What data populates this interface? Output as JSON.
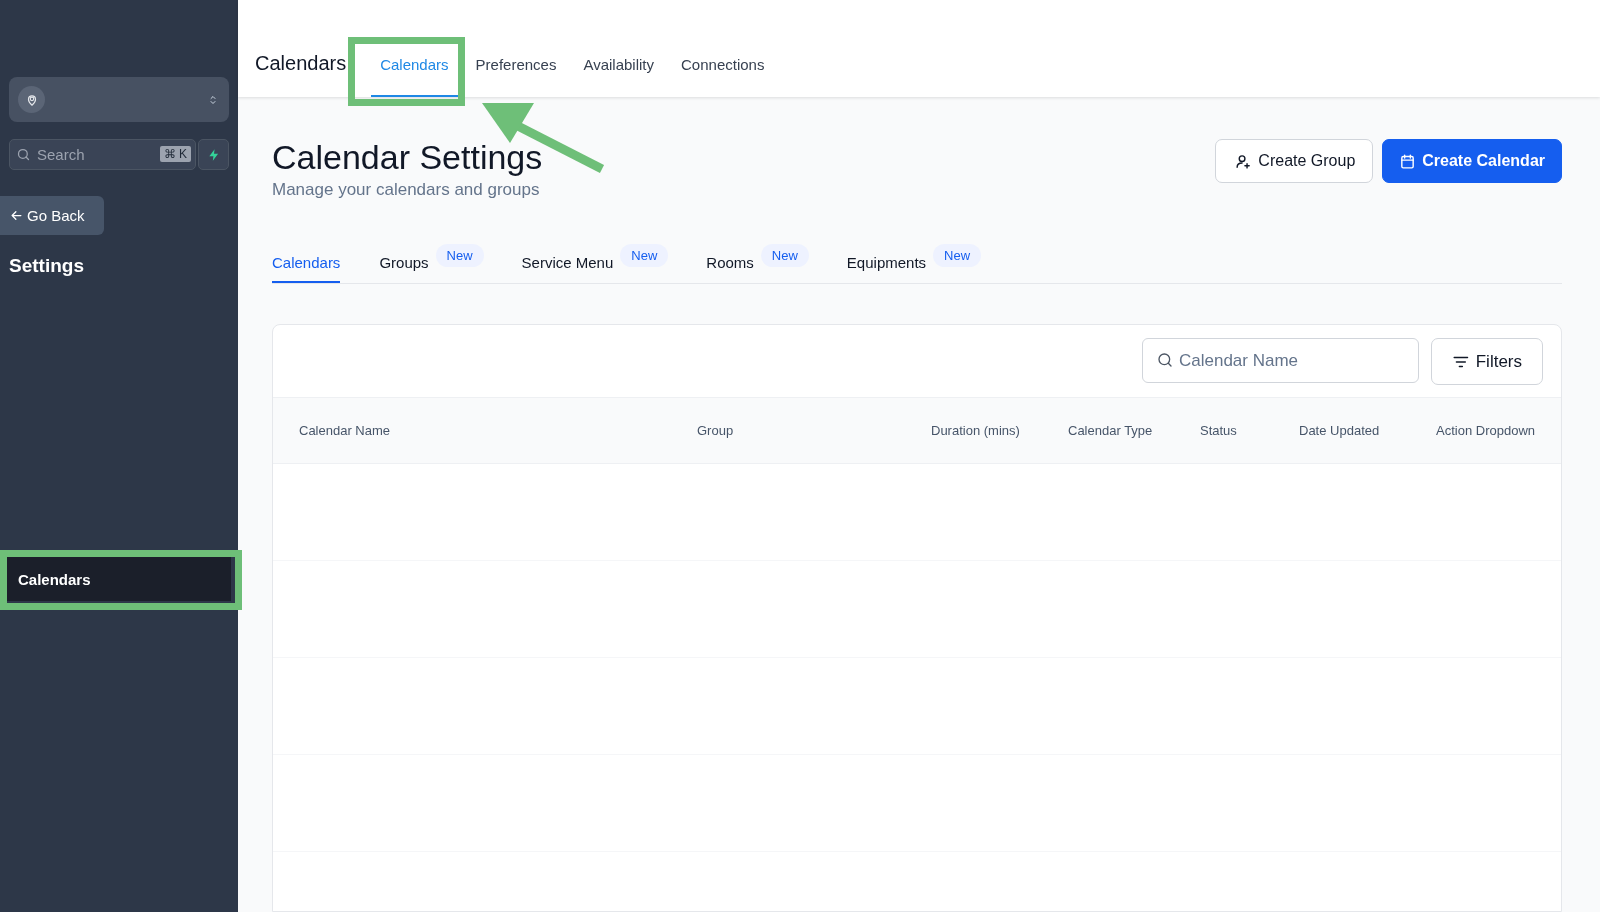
{
  "sidebar": {
    "search": {
      "placeholder": "Search",
      "shortcut": "⌘ K"
    },
    "back_button": "Go Back",
    "section_title": "Settings",
    "items": [
      {
        "label": "Calendars",
        "selected": true
      }
    ]
  },
  "top_nav": {
    "title": "Calendars",
    "tabs": [
      {
        "label": "Calendars",
        "selected": true
      },
      {
        "label": "Preferences",
        "selected": false
      },
      {
        "label": "Availability",
        "selected": false
      },
      {
        "label": "Connections",
        "selected": false
      }
    ]
  },
  "header": {
    "title": "Calendar Settings",
    "subtitle": "Manage your calendars and groups",
    "buttons": [
      {
        "label": "Create Group",
        "kind": "secondary"
      },
      {
        "label": "Create Calendar",
        "kind": "primary"
      }
    ]
  },
  "sub_tabs": [
    {
      "label": "Calendars",
      "selected": true
    },
    {
      "label": "Groups",
      "selected": false,
      "badge": "New"
    },
    {
      "label": "Service Menu",
      "selected": false,
      "badge": "New"
    },
    {
      "label": "Rooms",
      "selected": false,
      "badge": "New"
    },
    {
      "label": "Equipments",
      "selected": false,
      "badge": "New"
    }
  ],
  "table": {
    "search": {
      "placeholder": "Calendar Name"
    },
    "filter_button": "Filters",
    "columns": [
      "Calendar Name",
      "Group",
      "Duration (mins)",
      "Calendar Type",
      "Status",
      "Date Updated",
      "Action Dropdown"
    ]
  }
}
